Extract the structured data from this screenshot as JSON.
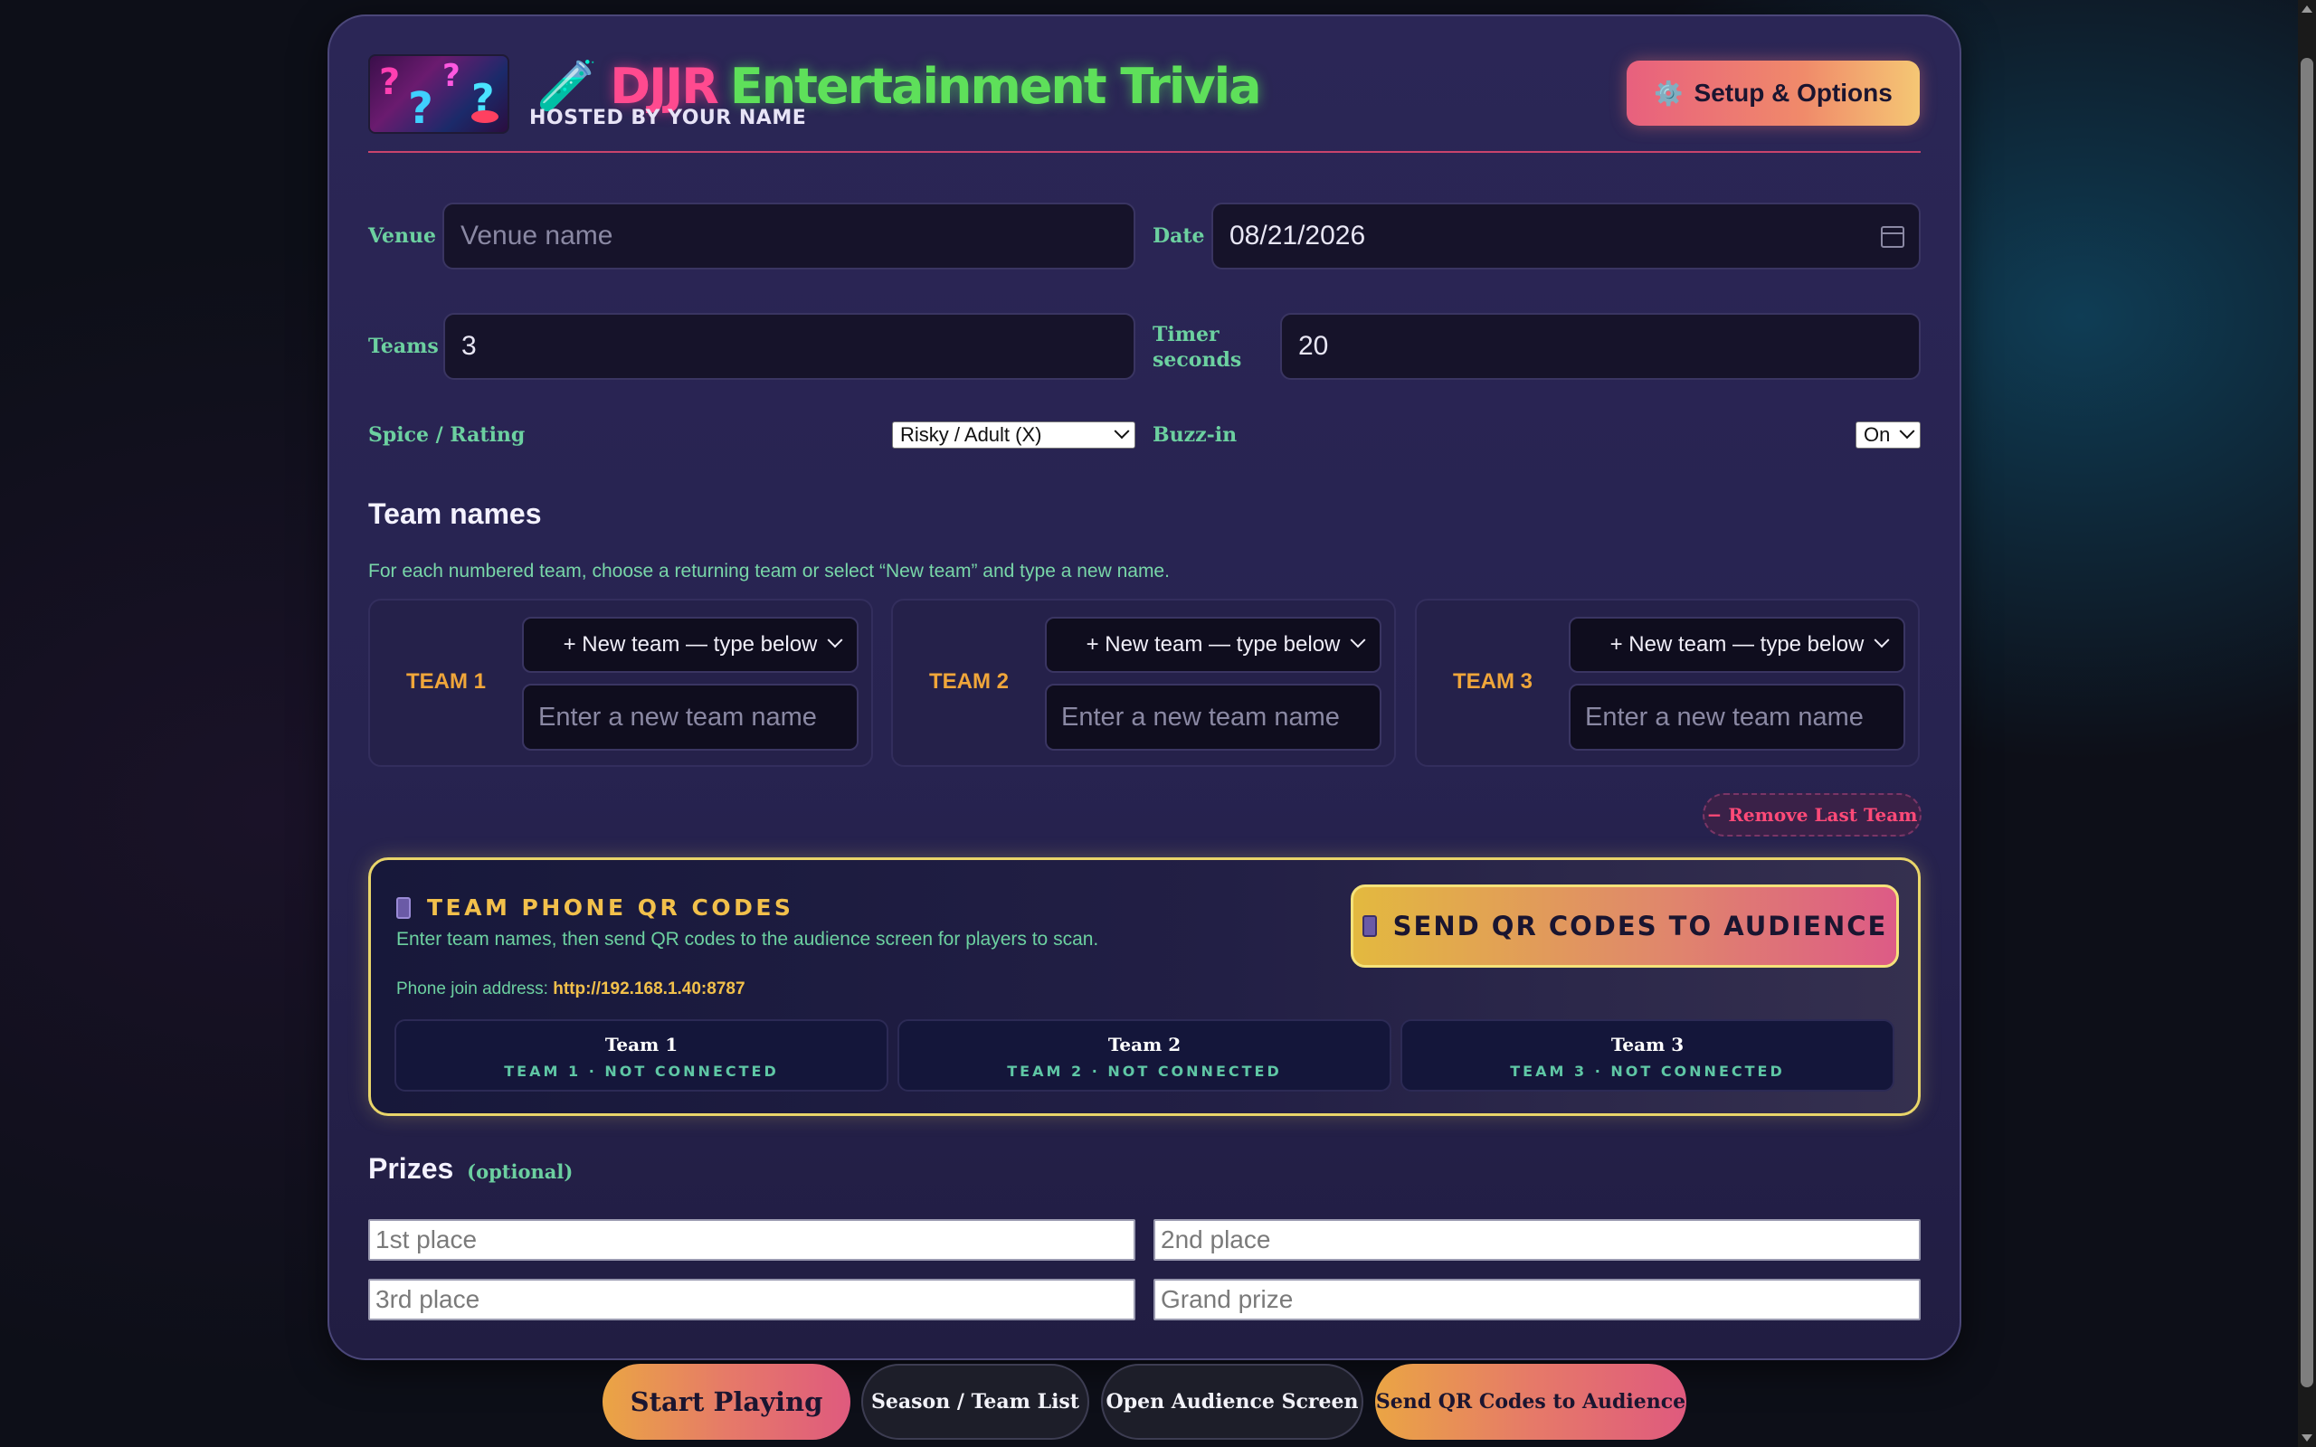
{
  "header": {
    "title_part1": "DJJR",
    "title_part2": "Entertainment Trivia",
    "hosted_by": "HOSTED BY YOUR NAME",
    "setup_label": "Setup & Options",
    "flask_glyph": "🧪",
    "gear_glyph": "⚙️"
  },
  "form": {
    "venue_label": "Venue",
    "venue_placeholder": "Venue name",
    "venue_value": "",
    "date_label": "Date",
    "date_value": "08/21/2026",
    "teams_label": "Teams",
    "teams_value": "3",
    "timer_label_line1": "Timer",
    "timer_label_line2": "seconds",
    "timer_value": "20",
    "spice_label": "Spice / Rating",
    "spice_value": "Risky / Adult (X)",
    "buzz_label": "Buzz-in",
    "buzz_value": "On"
  },
  "team_names": {
    "heading": "Team names",
    "hint": "For each numbered team, choose a returning team or select “New team” and type a new name.",
    "teams": [
      {
        "label": "TEAM 1",
        "select_value": "+  New team — type below",
        "placeholder": "Enter a new team name"
      },
      {
        "label": "TEAM 2",
        "select_value": "+  New team — type below",
        "placeholder": "Enter a new team name"
      },
      {
        "label": "TEAM 3",
        "select_value": "+  New team — type below",
        "placeholder": "Enter a new team name"
      }
    ],
    "remove_label": "− Remove Last Team"
  },
  "qr": {
    "title": "TEAM PHONE QR CODES",
    "description": "Enter team names, then send QR codes to the audience screen for players to scan.",
    "address_prefix": "Phone join address: ",
    "address": "http://192.168.1.40:8787",
    "send_label": "SEND QR CODES TO AUDIENCE",
    "teams": [
      {
        "name": "Team 1",
        "status": "TEAM 1 · NOT CONNECTED"
      },
      {
        "name": "Team 2",
        "status": "TEAM 2 · NOT CONNECTED"
      },
      {
        "name": "Team 3",
        "status": "TEAM 3 · NOT CONNECTED"
      }
    ]
  },
  "prizes": {
    "heading": "Prizes",
    "optional": "(optional)",
    "first_placeholder": "1st place",
    "second_placeholder": "2nd place",
    "third_placeholder": "3rd place",
    "grand_placeholder": "Grand prize"
  },
  "bottom_bar": {
    "start": "Start Playing",
    "season": "Season / Team List",
    "audience": "Open Audience Screen",
    "send_qr": "Send QR Codes to Audience"
  },
  "colors": {
    "accent_pink": "#ff4a8f",
    "accent_green": "#5ee05a",
    "label_green": "#6cd0a0",
    "gold": "#f2c04b"
  }
}
